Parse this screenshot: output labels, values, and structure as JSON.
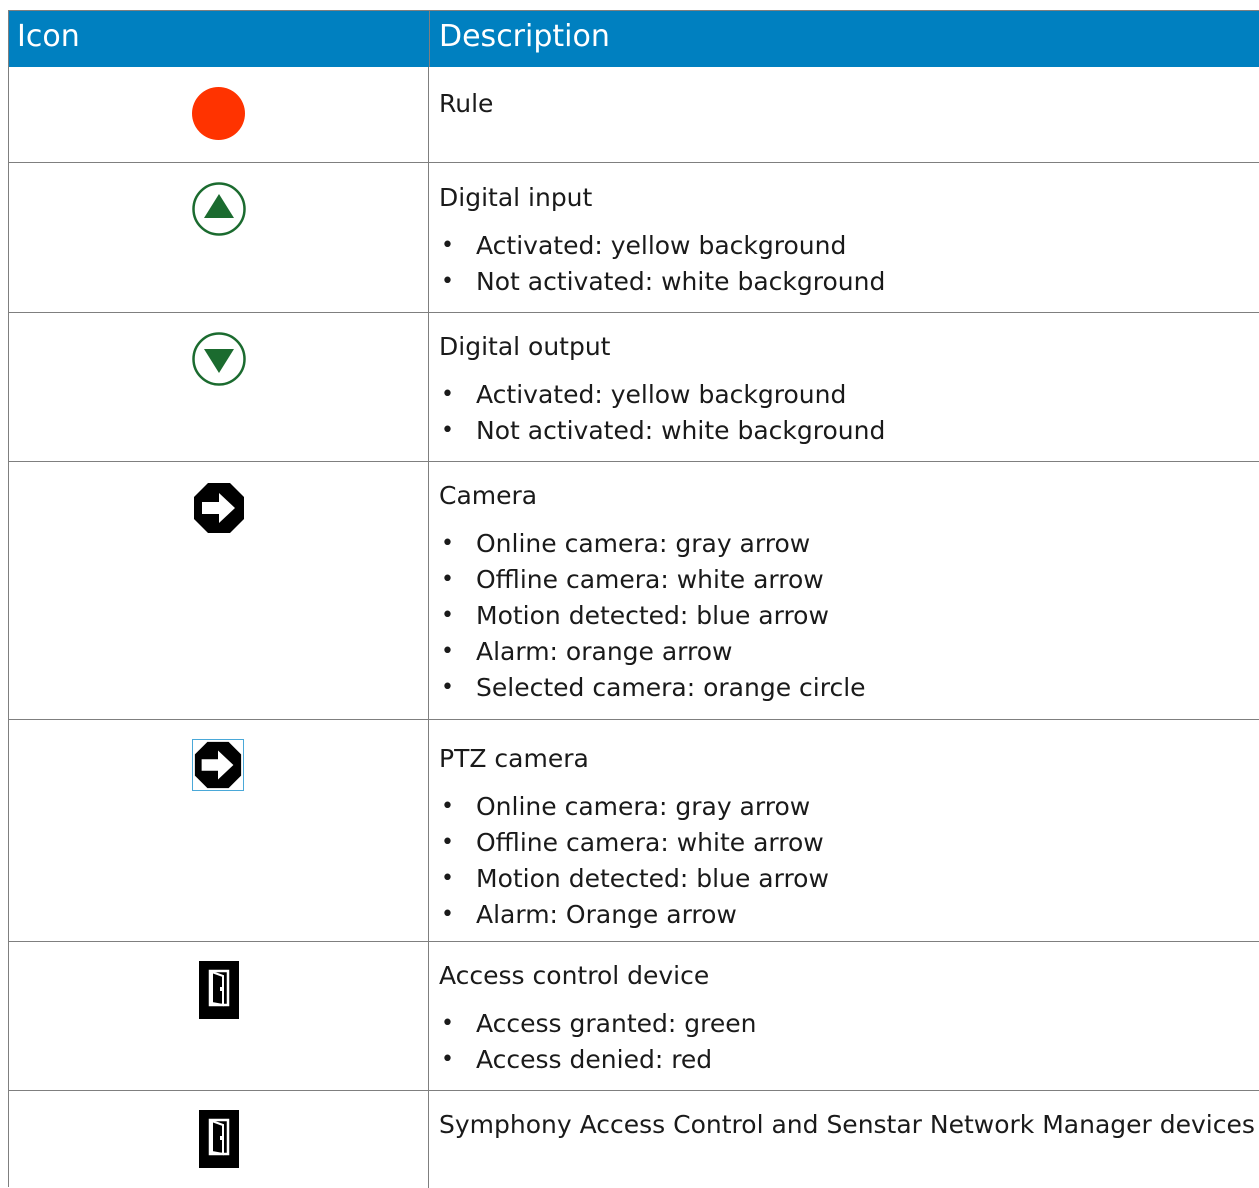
{
  "header": {
    "icon_label": "Icon",
    "description_label": "Description",
    "background": "#0080c0"
  },
  "rows": [
    {
      "icon": "red-circle-icon",
      "color": "#ff3300",
      "title": "Rule",
      "bullets": []
    },
    {
      "icon": "digital-input-up-triangle-icon",
      "color": "#1b6b2f",
      "title": "Digital input",
      "bullets": [
        "Activated: yellow background",
        "Not activated: white background"
      ]
    },
    {
      "icon": "digital-output-down-triangle-icon",
      "color": "#1b6b2f",
      "title": "Digital output",
      "bullets": [
        "Activated: yellow background",
        "Not activated: white background"
      ]
    },
    {
      "icon": "camera-arrow-icon",
      "color": "#000000",
      "title": "Camera",
      "bullets": [
        "Online camera: gray arrow",
        "Offline camera: white arrow",
        "Motion detected: blue arrow",
        "Alarm: orange arrow",
        "Selected camera: orange circle"
      ]
    },
    {
      "icon": "ptz-camera-arrow-icon",
      "color": "#000000",
      "title": "PTZ camera",
      "bullets": [
        "Online camera: gray arrow",
        "Offline camera: white arrow",
        "Motion detected: blue arrow",
        "Alarm: Orange arrow"
      ]
    },
    {
      "icon": "access-control-door-icon",
      "color": "#000000",
      "title": "Access control device",
      "bullets": [
        "Access granted: green",
        "Access denied: red"
      ]
    },
    {
      "icon": "symphony-door-icon",
      "color": "#000000",
      "title": "Symphony Access Control and Senstar Network Manager devices",
      "bullets": []
    }
  ]
}
